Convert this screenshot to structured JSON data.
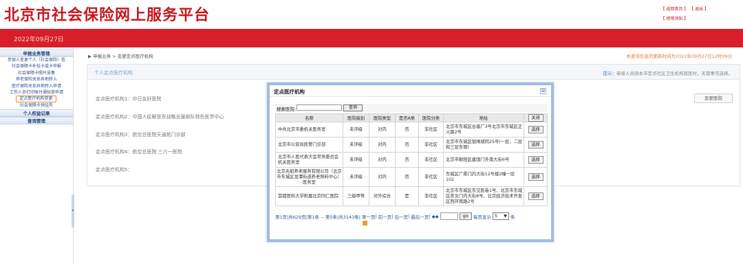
{
  "header": {
    "site_title": "北京市社会保险网上服务平台",
    "link_home": "【 返回首页 】",
    "link_logout": "【 退出 】",
    "link_notice": "【 使用须知 】",
    "date": "2022年09月27日"
  },
  "sidebar": {
    "section1": "申报业务管理",
    "items": [
      "参保人变更个人（社会保险）信",
      "社会保障卡补挂卡或卡申报",
      "社会保障卡照片采集",
      "养老保险关系异地转入",
      "医疗保险关系异地转入申请",
      "工伤人员打印账付通知单申请",
      "定点医疗机构变更",
      "社会保障卡预挂失"
    ],
    "section2": "个人权益记录",
    "section3": "查询管理"
  },
  "breadcrumb": "▶ 申报业务 > 变更定点医疗机构",
  "update_note": "本查询信息的更新时间为2022年09月27日12时09分",
  "panel": {
    "title": "个人定点医疗机构",
    "hint_prefix": "提示：",
    "hint": "参保人员则本市定点社区卫生机构就医时，无需事先选择。",
    "rows": [
      "定点医疗机构1：中日友好医院",
      "定点医疗机构2：中国人民解放军战略支援部队特色医学中心",
      "定点医疗机构3：航空总医院天通苑门诊部",
      "定点医疗机构4：航空总医院 三六一医院",
      "定点医疗机构5："
    ],
    "change_button": "变更医院"
  },
  "modal": {
    "title": "定点医疗机构",
    "close_icon": "⊠",
    "search_label": "搜索医院:",
    "search_value": "",
    "search_button": "查询",
    "columns": [
      "名称",
      "医院级别",
      "医院类型",
      "是否A类",
      "医院分类",
      "地址",
      "关闭"
    ],
    "rows": [
      {
        "name": "中共北京市委机关医务室",
        "level": "未评级",
        "type": "对内",
        "is_a": "否",
        "category": "非社区",
        "address": "北京市东城区台基厂3号北京市东城区正义路2号",
        "action": "选择"
      },
      {
        "name": "北京市公安局民警门诊部",
        "level": "未评级",
        "type": "对内",
        "is_a": "否",
        "category": "非社区",
        "address": "北京市东城区银闸胡同25号(一层、二层和三层东侧)",
        "action": "选择"
      },
      {
        "name": "北京市人民代表大会常务委员会机关医务室",
        "level": "未评级",
        "type": "对内",
        "is_a": "否",
        "category": "非社区",
        "address": "北京市朝阳区建国门外南大街6号",
        "action": "选择"
      },
      {
        "name": "北京兆如养老服务有限公司（北京市东城区龙潭街道养老照料中心）医务室",
        "level": "未评级",
        "type": "对内",
        "is_a": "否",
        "category": "非社区",
        "address": "东城区广渠门内大街12号楼2幢一层102",
        "action": "选择"
      },
      {
        "name": "首都医科大学附属北京同仁医院",
        "level": "三级甲等",
        "type": "对外综合",
        "is_a": "是",
        "category": "非社区",
        "address": "北京市东城区东交民巷1号、北京市东城区崇文门内大街8号、北京经济技术开发区西环南路2号",
        "action": "选择"
      }
    ],
    "pager": {
      "summary": "第1页|共629页|第1条 -- 第5条|共3143条|",
      "first": "第一页",
      "prev": "前一页",
      "next": "后一页",
      "last": "最后一页",
      "arrows": "◆◆",
      "page_value": "",
      "go": "go",
      "per_page_label": "每页显示",
      "per_page": "5",
      "unit": "条"
    }
  }
}
